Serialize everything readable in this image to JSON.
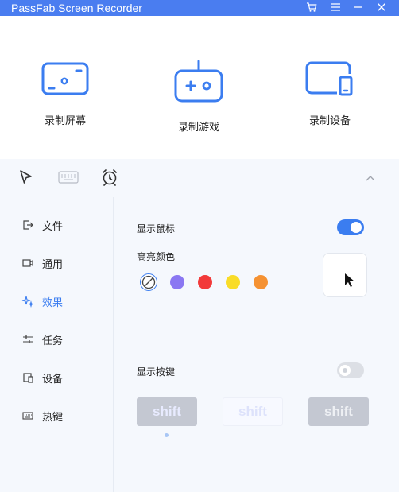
{
  "window": {
    "title": "PassFab Screen Recorder"
  },
  "titlebar_icons": [
    "cart-icon",
    "menu-icon",
    "minimize-icon",
    "close-icon"
  ],
  "modes": [
    {
      "label": "录制屏幕",
      "icon": "screen-record-icon"
    },
    {
      "label": "录制游戏",
      "icon": "gamepad-icon"
    },
    {
      "label": "录制设备",
      "icon": "device-icon"
    }
  ],
  "toolbar": {
    "icons": [
      "cursor-icon",
      "keyboard-icon",
      "alarm-clock-icon"
    ],
    "collapse_icon": "chevron-up-icon"
  },
  "sidebar": {
    "items": [
      {
        "label": "文件",
        "icon": "file-export-icon",
        "active": false
      },
      {
        "label": "通用",
        "icon": "camera-icon",
        "active": false
      },
      {
        "label": "效果",
        "icon": "sparkle-icon",
        "active": true
      },
      {
        "label": "任务",
        "icon": "sliders-icon",
        "active": false
      },
      {
        "label": "设备",
        "icon": "device-small-icon",
        "active": false
      },
      {
        "label": "热键",
        "icon": "keyboard-small-icon",
        "active": false
      }
    ]
  },
  "effects": {
    "show_mouse": {
      "label": "显示鼠标",
      "enabled": true
    },
    "highlight_color": {
      "label": "高亮颜色",
      "options": [
        {
          "name": "none",
          "color": "#ffffff",
          "selected": true
        },
        {
          "name": "purple",
          "color": "#8a77f2",
          "selected": false
        },
        {
          "name": "red",
          "color": "#f23a3a",
          "selected": false
        },
        {
          "name": "yellow",
          "color": "#f9dc28",
          "selected": false
        },
        {
          "name": "orange",
          "color": "#f59233",
          "selected": false
        }
      ]
    },
    "show_keys": {
      "label": "显示按键",
      "enabled": false
    },
    "key_styles": [
      {
        "label": "shift"
      },
      {
        "label": "shift"
      },
      {
        "label": "shift"
      }
    ]
  },
  "colors": {
    "accent": "#3b7df0",
    "titlebar": "#4a7df0",
    "panel_bg": "#f5f8fd"
  }
}
